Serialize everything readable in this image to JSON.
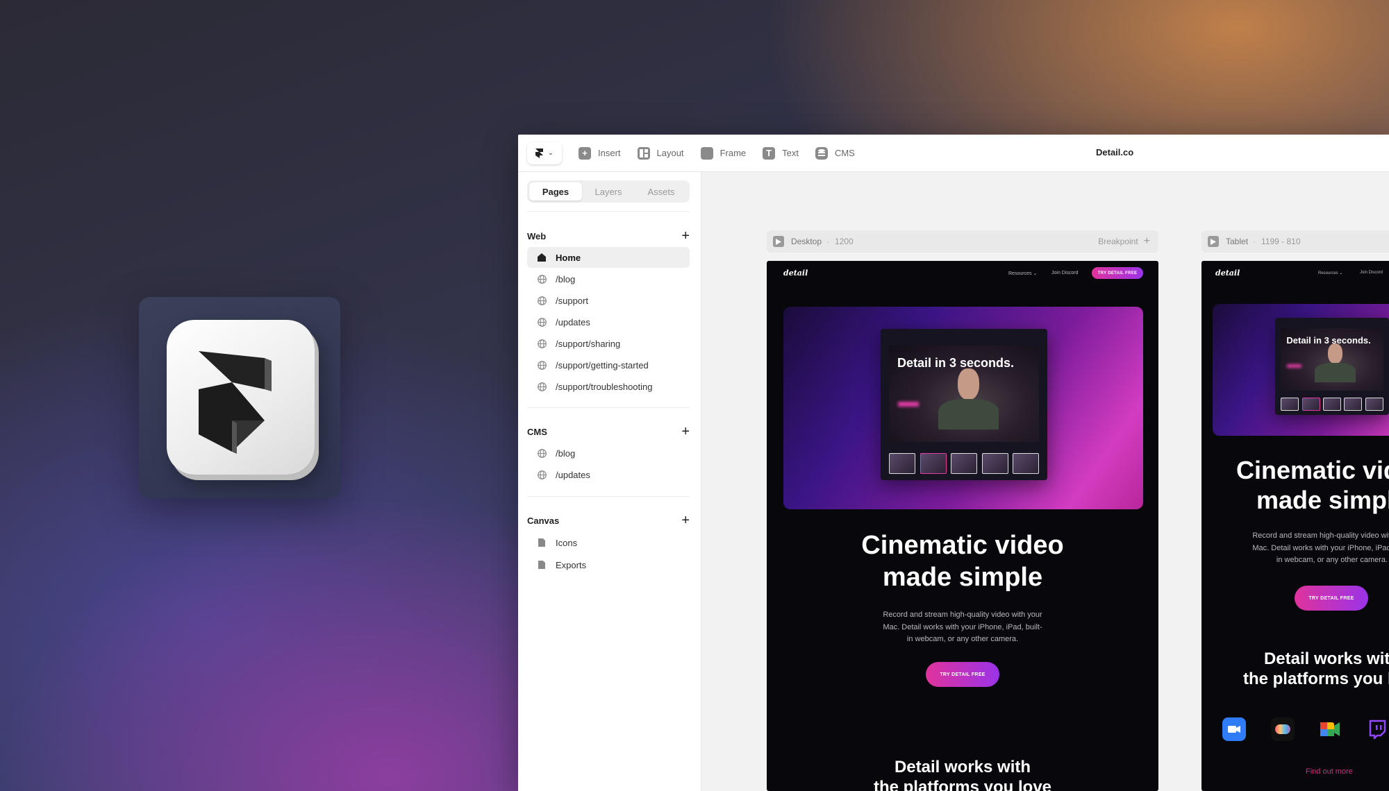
{
  "toolbar": {
    "tools": [
      {
        "label": "Insert",
        "icon": "plus-square-icon"
      },
      {
        "label": "Layout",
        "icon": "layout-icon"
      },
      {
        "label": "Frame",
        "icon": "frame-icon"
      },
      {
        "label": "Text",
        "icon": "text-icon"
      },
      {
        "label": "CMS",
        "icon": "database-icon"
      }
    ],
    "document_title": "Detail.co"
  },
  "sidebar": {
    "tabs": [
      {
        "label": "Pages",
        "active": true
      },
      {
        "label": "Layers",
        "active": false
      },
      {
        "label": "Assets",
        "active": false
      }
    ],
    "sections": [
      {
        "title": "Web",
        "items": [
          {
            "label": "Home",
            "icon": "home-icon",
            "active": true
          },
          {
            "label": "/blog",
            "icon": "globe-icon"
          },
          {
            "label": "/support",
            "icon": "globe-icon"
          },
          {
            "label": "/updates",
            "icon": "globe-icon"
          },
          {
            "label": "/support/sharing",
            "icon": "globe-icon"
          },
          {
            "label": "/support/getting-started",
            "icon": "globe-icon"
          },
          {
            "label": "/support/troubleshooting",
            "icon": "globe-icon"
          }
        ]
      },
      {
        "title": "CMS",
        "items": [
          {
            "label": "/blog",
            "icon": "globe-icon"
          },
          {
            "label": "/updates",
            "icon": "globe-icon"
          }
        ]
      },
      {
        "title": "Canvas",
        "items": [
          {
            "label": "Icons",
            "icon": "file-icon"
          },
          {
            "label": "Exports",
            "icon": "file-icon"
          }
        ]
      }
    ]
  },
  "canvas": {
    "desktop": {
      "label": "Desktop",
      "size": "1200",
      "breakpoint_label": "Breakpoint",
      "site": {
        "logo": "detail",
        "nav": [
          "Resources ⌄",
          "Join Discord"
        ],
        "cta_nav": "TRY DETAIL FREE",
        "hero_overlay": "Detail in 3 seconds.",
        "headline_line1": "Cinematic video",
        "headline_line2": "made simple",
        "body_line1": "Record and stream high-quality video with your",
        "body_line2": "Mac. Detail works with your iPhone, iPad, built-",
        "body_line3": "in webcam, or any other camera.",
        "cta": "TRY DETAIL FREE",
        "subhead_line1": "Detail works with",
        "subhead_line2": "the platforms you love"
      }
    },
    "tablet": {
      "label": "Tablet",
      "size": "1199 - 810",
      "site": {
        "logo": "detail",
        "nav": [
          "Resources ⌄",
          "Join Discord"
        ],
        "hero_overlay": "Detail in 3 seconds.",
        "headline_line1": "Cinematic video",
        "headline_line2": "made simple",
        "body_line1": "Record and stream high-quality video with your",
        "body_line2": "Mac. Detail works with your iPhone, iPad, built-",
        "body_line3": "in webcam, or any other camera.",
        "cta": "TRY DETAIL FREE",
        "subhead_line1": "Detail works with",
        "subhead_line2": "the platforms you love",
        "platforms": [
          "zoom-icon",
          "meet-icon-colorful",
          "google-meet-icon",
          "twitch-icon"
        ],
        "find_out_more": "Find out more"
      }
    }
  },
  "colors": {
    "accent_pink": "#e0339c",
    "accent_purple": "#9a33e8",
    "site_bg": "#07070c"
  }
}
